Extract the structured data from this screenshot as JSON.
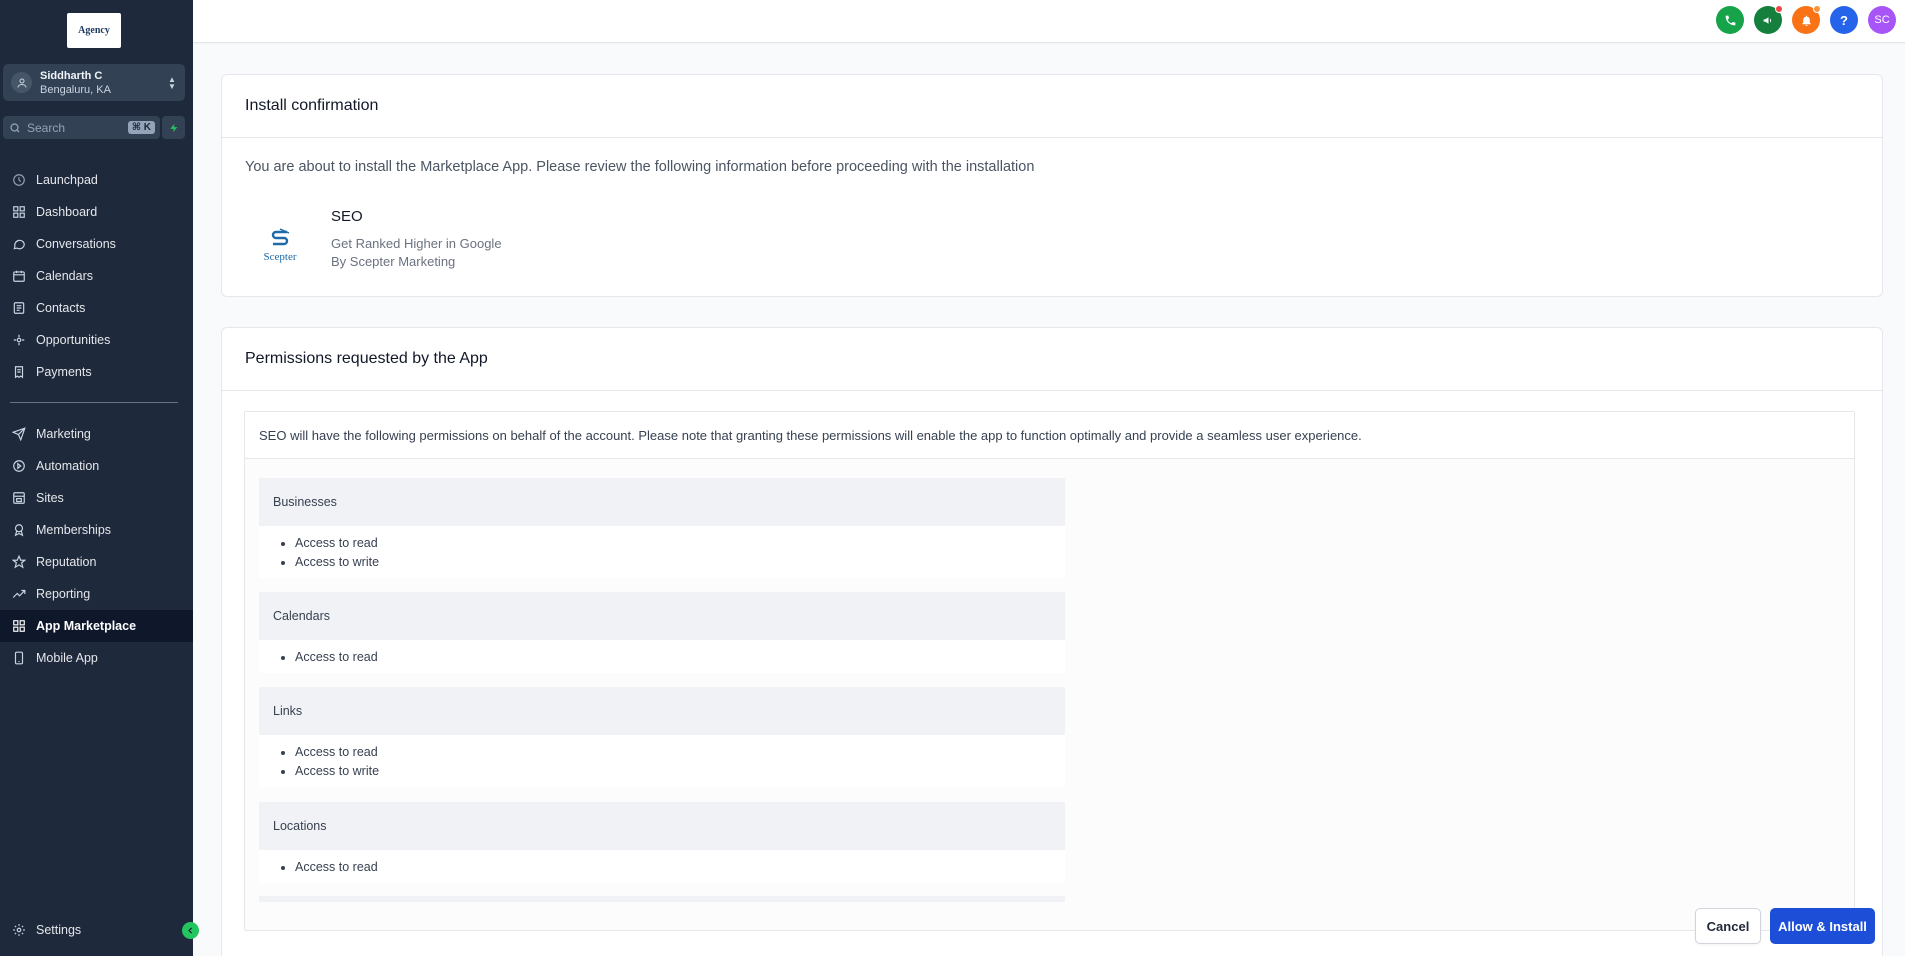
{
  "sidebar": {
    "logo_text": "Agency",
    "account": {
      "name": "Siddharth C",
      "location": "Bengaluru, KA"
    },
    "search": {
      "placeholder": "Search",
      "shortcut": "⌘ K"
    },
    "items_top": [
      {
        "label": "Launchpad",
        "icon": "rocket-icon"
      },
      {
        "label": "Dashboard",
        "icon": "grid-icon"
      },
      {
        "label": "Conversations",
        "icon": "chat-icon"
      },
      {
        "label": "Calendars",
        "icon": "calendar-icon"
      },
      {
        "label": "Contacts",
        "icon": "contacts-icon"
      },
      {
        "label": "Opportunities",
        "icon": "opportunities-icon"
      },
      {
        "label": "Payments",
        "icon": "receipt-icon"
      }
    ],
    "items_bottom": [
      {
        "label": "Marketing",
        "icon": "send-icon"
      },
      {
        "label": "Automation",
        "icon": "automation-icon"
      },
      {
        "label": "Sites",
        "icon": "sites-icon"
      },
      {
        "label": "Memberships",
        "icon": "award-icon"
      },
      {
        "label": "Reputation",
        "icon": "star-icon"
      },
      {
        "label": "Reporting",
        "icon": "trend-icon"
      },
      {
        "label": "App Marketplace",
        "icon": "apps-icon",
        "active": true
      },
      {
        "label": "Mobile App",
        "icon": "phone-icon"
      }
    ],
    "settings_label": "Settings"
  },
  "topbar": {
    "avatar_initials": "SC",
    "help_glyph": "?",
    "colors": {
      "phone": "#16a34a",
      "announce": "#15803d",
      "bell": "#f97316",
      "help": "#2563eb",
      "avatar": "#a855f7"
    }
  },
  "install": {
    "title": "Install confirmation",
    "intro": "You are about to install the Marketplace App. Please review the following information before proceeding with the installation",
    "app": {
      "logo_text": "Scepter",
      "name": "SEO",
      "description": "Get Ranked Higher in Google",
      "by": "By Scepter Marketing"
    }
  },
  "permissions": {
    "title": "Permissions requested by the App",
    "note": "SEO will have the following permissions on behalf of the account. Please note that granting these permissions will enable the app to function optimally and provide a seamless user experience.",
    "groups": [
      {
        "name": "Businesses",
        "items": [
          "Access to read",
          "Access to write"
        ]
      },
      {
        "name": "Calendars",
        "items": [
          "Access to read"
        ]
      },
      {
        "name": "Links",
        "items": [
          "Access to read",
          "Access to write"
        ]
      },
      {
        "name": "Locations",
        "items": [
          "Access to read"
        ]
      }
    ]
  },
  "actions": {
    "cancel": "Cancel",
    "install": "Allow & Install"
  }
}
